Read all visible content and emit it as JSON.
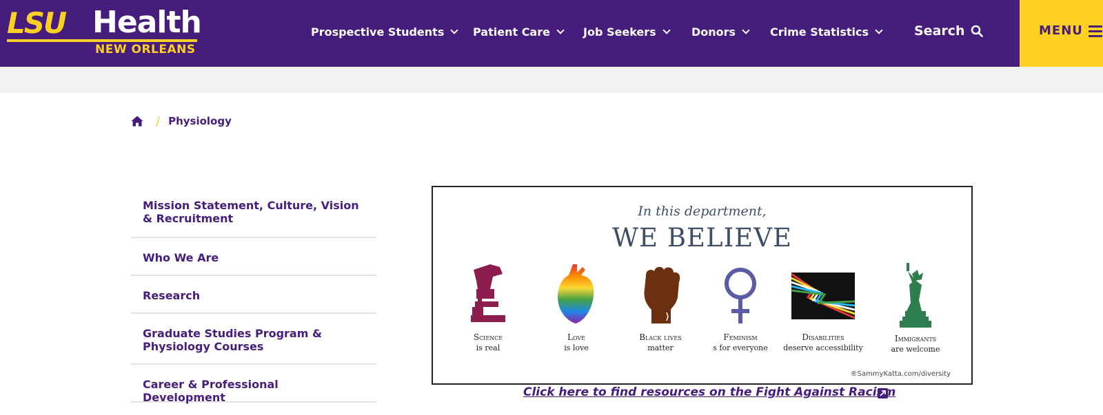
{
  "header": {
    "logo": {
      "lsu": "LSU",
      "health": "Health",
      "subtitle": "NEW ORLEANS"
    },
    "nav": [
      {
        "label": "Prospective Students"
      },
      {
        "label": "Patient Care"
      },
      {
        "label": "Job Seekers"
      },
      {
        "label": "Donors"
      },
      {
        "label": "Crime Statistics"
      }
    ],
    "search_label": "Search",
    "menu_label": "MENU"
  },
  "breadcrumb": {
    "home_icon": "home-icon",
    "current": "Physiology"
  },
  "sidebar": {
    "items": [
      {
        "label": "Mission Statement, Culture, Vision & Recruitment"
      },
      {
        "label": "Who We Are"
      },
      {
        "label": "Research"
      },
      {
        "label": "Graduate Studies Program & Physiology Courses"
      },
      {
        "label": "Career & Professional Development"
      }
    ]
  },
  "banner": {
    "intro": "In this department,",
    "title": "WE BELIEVE",
    "beliefs": [
      {
        "title": "Science",
        "sub": "is real",
        "icon": "microscope-icon"
      },
      {
        "title": "Love",
        "sub": "is love",
        "icon": "rainbow-heart-icon"
      },
      {
        "title": "Black lives",
        "sub": "matter",
        "icon": "raised-fist-icon"
      },
      {
        "title": "Feminism",
        "sub": "s for everyone",
        "icon": "venus-symbol-icon"
      },
      {
        "title": "Disabilities",
        "sub": "deserve accessibility",
        "icon": "disability-flag-icon"
      },
      {
        "title": "Immigrants",
        "sub": "are welcome",
        "icon": "statue-of-liberty-icon"
      }
    ],
    "credit": "®SammyKatta.com/diversity"
  },
  "racism_link": "Click here to find resources on the Fight Against Racism",
  "colors": {
    "purple": "#461d7c",
    "gold": "#fdd023",
    "banner_text": "#3d4e66"
  }
}
